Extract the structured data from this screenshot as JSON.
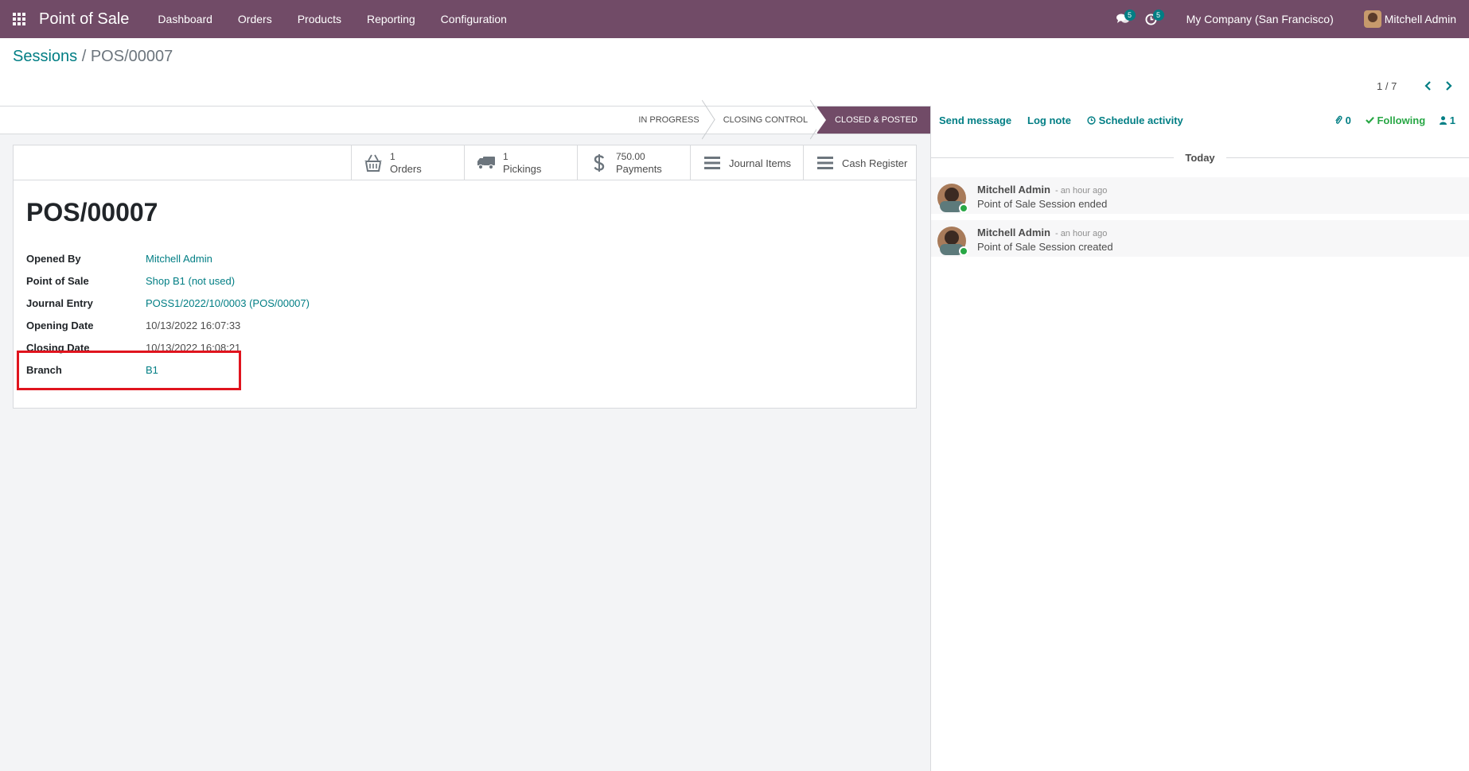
{
  "navbar": {
    "app_name": "Point of Sale",
    "menu": [
      "Dashboard",
      "Orders",
      "Products",
      "Reporting",
      "Configuration"
    ],
    "messages_count": "5",
    "activities_count": "5",
    "company": "My Company (San Francisco)",
    "user": "Mitchell Admin"
  },
  "breadcrumb": {
    "parent": "Sessions",
    "separator": "/",
    "current": "POS/00007"
  },
  "pager": {
    "value": "1 / 7"
  },
  "statusbar": {
    "steps": [
      "IN PROGRESS",
      "CLOSING CONTROL",
      "CLOSED & POSTED"
    ],
    "active": "CLOSED & POSTED"
  },
  "smart_buttons": {
    "orders": {
      "value": "1",
      "label": "Orders"
    },
    "pickings": {
      "value": "1",
      "label": "Pickings"
    },
    "payments": {
      "value": "750.00",
      "label": "Payments"
    },
    "journal_items": {
      "label": "Journal Items"
    },
    "cash_register": {
      "label": "Cash Register"
    }
  },
  "record": {
    "title": "POS/00007",
    "fields": {
      "opened_by": {
        "label": "Opened By",
        "value": "Mitchell Admin"
      },
      "point_of_sale": {
        "label": "Point of Sale",
        "value": "Shop B1 (not used)"
      },
      "journal_entry": {
        "label": "Journal Entry",
        "value": "POSS1/2022/10/0003 (POS/00007)"
      },
      "opening_date": {
        "label": "Opening Date",
        "value": "10/13/2022 16:07:33"
      },
      "closing_date": {
        "label": "Closing Date",
        "value": "10/13/2022 16:08:21"
      },
      "branch": {
        "label": "Branch",
        "value": "B1"
      }
    }
  },
  "chatter": {
    "send_message": "Send message",
    "log_note": "Log note",
    "schedule_activity": "Schedule activity",
    "attachments_count": "0",
    "following": "Following",
    "followers_count": "1",
    "day_label": "Today",
    "messages": [
      {
        "author": "Mitchell Admin",
        "date": "- an hour ago",
        "body": "Point of Sale Session ended"
      },
      {
        "author": "Mitchell Admin",
        "date": "- an hour ago",
        "body": "Point of Sale Session created"
      }
    ]
  },
  "colors": {
    "brand": "#714b67",
    "link": "#017e84",
    "highlight": "#e0141e",
    "following": "#28a745"
  }
}
